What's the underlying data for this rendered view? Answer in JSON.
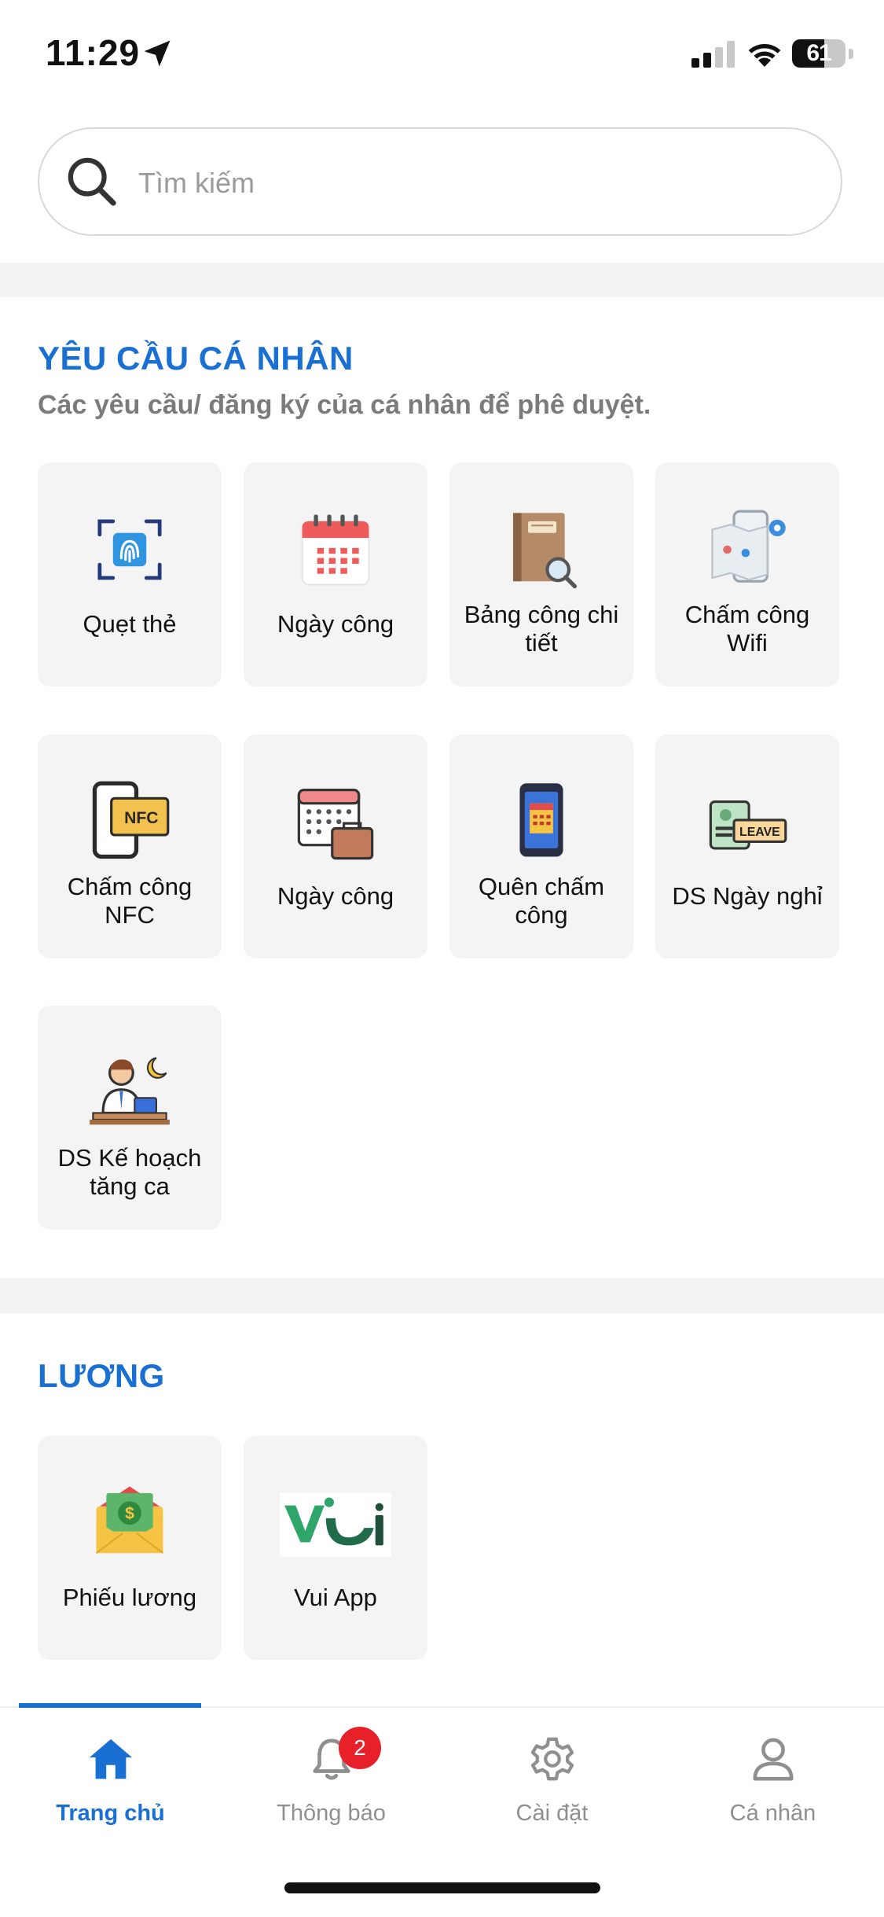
{
  "status_bar": {
    "time": "11:29",
    "battery": "61",
    "battery_level": 0.61
  },
  "search": {
    "placeholder": "Tìm kiếm"
  },
  "personal": {
    "title": "YÊU CẦU CÁ NHÂN",
    "subtitle": "Các yêu cầu/ đăng ký của cá nhân để phê duyệt.",
    "items": [
      {
        "label": "Quẹt thẻ",
        "icon": "fingerprint-scan-icon"
      },
      {
        "label": "Ngày công",
        "icon": "calendar-icon"
      },
      {
        "label": "Bảng công chi tiết",
        "icon": "ledger-search-icon"
      },
      {
        "label": "Chấm công Wifi",
        "icon": "phone-map-pin-icon"
      },
      {
        "label": "Chấm công NFC",
        "icon": "phone-nfc-icon"
      },
      {
        "label": "Ngày công",
        "icon": "calendar-briefcase-icon"
      },
      {
        "label": "Quên chấm công",
        "icon": "phone-calendar-icon"
      },
      {
        "label": "DS Ngày nghỉ",
        "icon": "leave-card-icon"
      },
      {
        "label": "DS Kế hoạch tăng ca",
        "icon": "overtime-worker-icon"
      }
    ]
  },
  "salary": {
    "title": "LƯƠNG",
    "items": [
      {
        "label": "Phiếu lương",
        "icon": "payslip-envelope-icon"
      },
      {
        "label": "Vui App",
        "icon": "vui-app-logo-icon"
      }
    ]
  },
  "tabbar": {
    "tabs": [
      {
        "label": "Trang chủ",
        "icon": "home-icon",
        "active": true
      },
      {
        "label": "Thông báo",
        "icon": "bell-icon",
        "badge": "2"
      },
      {
        "label": "Cài đặt",
        "icon": "gear-icon"
      },
      {
        "label": "Cá nhân",
        "icon": "user-icon"
      }
    ]
  },
  "colors": {
    "accent": "#1a6fd3",
    "badge": "#e8202a",
    "tile_bg": "#f4f4f4",
    "subtitle": "#7b7b7b"
  }
}
